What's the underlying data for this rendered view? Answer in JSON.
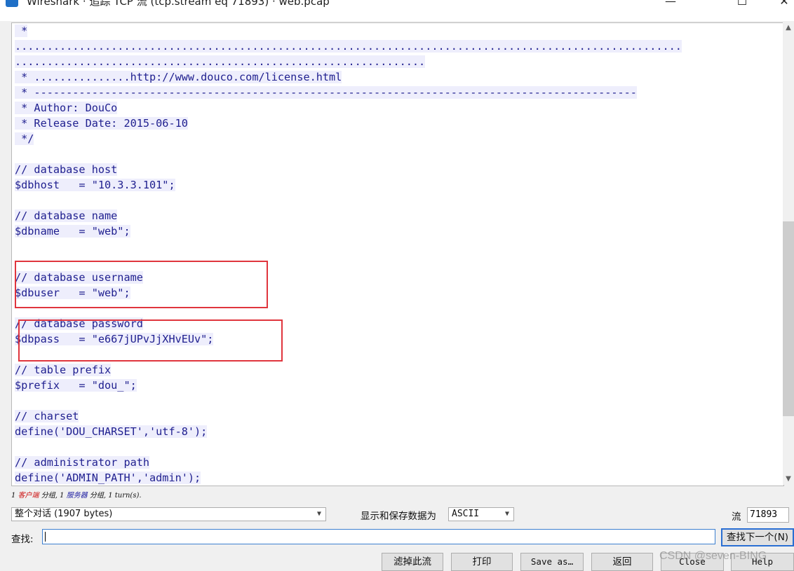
{
  "window": {
    "title": "Wireshark · 追踪 TCP 流 (tcp.stream eq 71893) · web.pcap",
    "minimize": "—",
    "maximize": "☐",
    "close": "✕"
  },
  "stream_lines": [
    " *",
    "........................................................................................................",
    "................................................................",
    " * ...............http://www.douco.com/license.html",
    " * ----------------------------------------------------------------------------------------------",
    " * Author: DouCo",
    " * Release Date: 2015-06-10",
    " */",
    "",
    "// database host",
    "$dbhost   = \"10.3.3.101\";",
    "",
    "// database name",
    "$dbname   = \"web\";",
    "",
    "",
    "// database username",
    "$dbuser   = \"web\";",
    "",
    "// database password",
    "$dbpass   = \"e667jUPvJjXHvEUv\";",
    "",
    "// table prefix",
    "$prefix   = \"dou_\";",
    "",
    "// charset",
    "define('DOU_CHARSET','utf-8');",
    "",
    "// administrator path",
    "define('ADMIN_PATH','admin');"
  ],
  "summary": {
    "client_count": "1",
    "client_label": "客户端",
    "client_suffix": "分组, 1",
    "server_label": "服务器",
    "server_suffix": "分组, 1 turn(s).",
    "lead_space": " "
  },
  "controls": {
    "conversation_select": "整个对话 (1907 bytes)",
    "show_as_label": "显示和保存数据为",
    "show_as_select": "ASCII",
    "stream_label": "流",
    "stream_value": "71893",
    "find_label": "查找:",
    "find_value": "",
    "find_next": "查找下一个(N)"
  },
  "buttons": {
    "filter_out": "滤掉此流",
    "print": "打印",
    "save_as": "Save as…",
    "back": "返回",
    "close": "Close",
    "help": "Help"
  },
  "watermark": "CSDN @seven-BING",
  "colors": {
    "stream_text": "#1f1f8f",
    "line_background": "#eeeefc",
    "annotation_box": "#e0353d"
  }
}
